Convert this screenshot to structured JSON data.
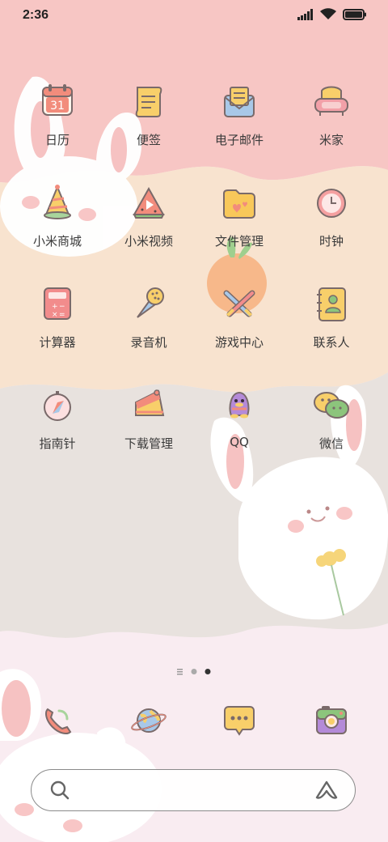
{
  "status_bar": {
    "time": "2:36"
  },
  "apps": [
    {
      "label": "日历",
      "icon": "calendar-icon",
      "badge": "31"
    },
    {
      "label": "便签",
      "icon": "notes-icon"
    },
    {
      "label": "电子邮件",
      "icon": "mail-icon"
    },
    {
      "label": "米家",
      "icon": "sofa-icon"
    },
    {
      "label": "小米商城",
      "icon": "party-hat-icon"
    },
    {
      "label": "小米视频",
      "icon": "watermelon-play-icon"
    },
    {
      "label": "文件管理",
      "icon": "folder-icon"
    },
    {
      "label": "时钟",
      "icon": "clock-icon"
    },
    {
      "label": "计算器",
      "icon": "calculator-icon"
    },
    {
      "label": "录音机",
      "icon": "microphone-icon"
    },
    {
      "label": "游戏中心",
      "icon": "crossed-swords-icon"
    },
    {
      "label": "联系人",
      "icon": "contacts-book-icon"
    },
    {
      "label": "指南针",
      "icon": "compass-icon"
    },
    {
      "label": "下载管理",
      "icon": "cake-slice-icon"
    },
    {
      "label": "QQ",
      "icon": "qq-penguin-icon"
    },
    {
      "label": "微信",
      "icon": "wechat-icon"
    }
  ],
  "page_indicator": {
    "pages": 2,
    "current": 2
  },
  "dock": [
    {
      "icon": "phone-icon"
    },
    {
      "icon": "planet-browser-icon"
    },
    {
      "icon": "message-bubble-icon"
    },
    {
      "icon": "camera-icon"
    }
  ],
  "colors": {
    "pink": "#f7c6c4",
    "peach": "#f8e3cf",
    "grey": "#e8e2de",
    "bottom": "#f9ecf1"
  }
}
